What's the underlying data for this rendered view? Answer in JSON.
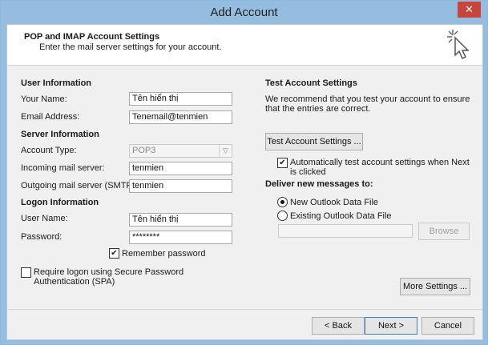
{
  "window": {
    "title": "Add Account",
    "close_glyph": "✕"
  },
  "header": {
    "title": "POP and IMAP Account Settings",
    "subtitle": "Enter the mail server settings for your account."
  },
  "user_info": {
    "heading": "User Information",
    "name_label": "Your Name:",
    "name_value": "Tên hiển thị",
    "email_label": "Email Address:",
    "email_value": "Tenemail@tenmien"
  },
  "server_info": {
    "heading": "Server Information",
    "account_type_label": "Account Type:",
    "account_type_value": "POP3",
    "incoming_label": "Incoming mail server:",
    "incoming_value": "tenmien",
    "outgoing_label": "Outgoing mail server (SMTP):",
    "outgoing_value": "tenmien"
  },
  "logon_info": {
    "heading": "Logon Information",
    "username_label": "User Name:",
    "username_value": "Tên hiển thị",
    "password_label": "Password:",
    "password_value": "********",
    "remember_label": "Remember password",
    "remember_checked": true,
    "spa_label": "Require logon using Secure Password Authentication (SPA)",
    "spa_checked": false
  },
  "test_settings": {
    "heading": "Test Account Settings",
    "description": "We recommend that you test your account to ensure that the entries are correct.",
    "test_button": "Test Account Settings ...",
    "auto_test_label": "Automatically test account settings when Next is clicked",
    "auto_test_checked": true
  },
  "deliver": {
    "heading": "Deliver new messages to:",
    "new_file_label": "New Outlook Data File",
    "existing_file_label": "Existing Outlook Data File",
    "selected": "new",
    "browse_button": "Browse"
  },
  "more_settings_button": "More Settings ...",
  "footer": {
    "back_button": "< Back",
    "next_button": "Next >",
    "cancel_button": "Cancel"
  },
  "icons": {
    "header": "cursor-sparkle-icon",
    "check": "✔"
  }
}
